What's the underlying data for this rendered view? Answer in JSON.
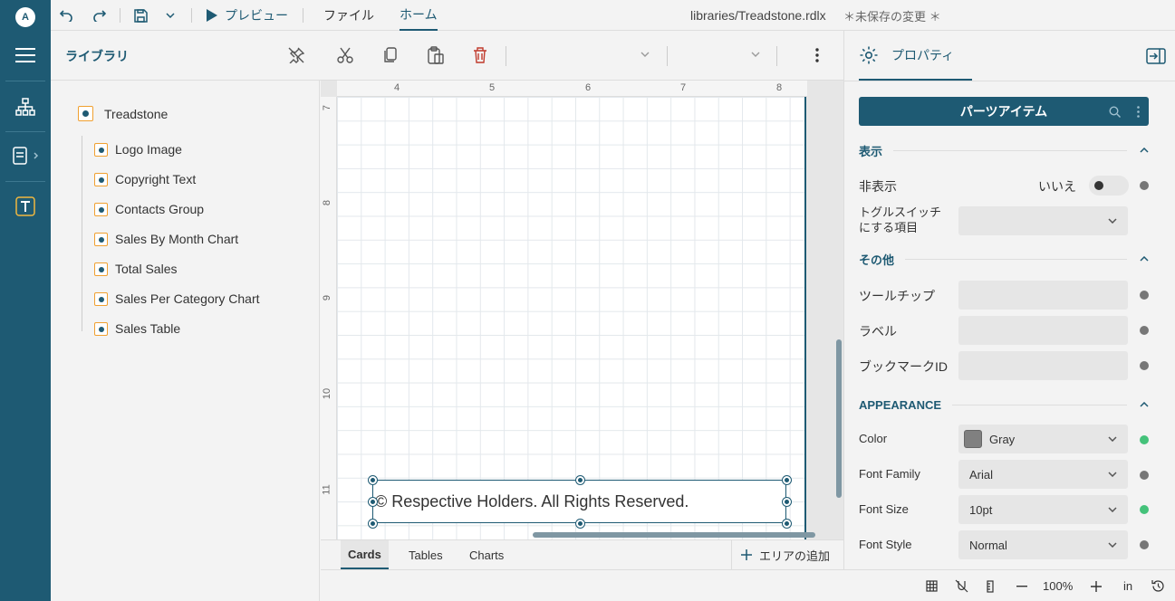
{
  "rail": {
    "logo": "A"
  },
  "topbar": {
    "preview_label": "プレビュー",
    "tabs": [
      {
        "label": "ファイル"
      },
      {
        "label": "ホーム"
      }
    ],
    "filename": "libraries/Treadstone.rdlx",
    "unsaved": "＊未保存の変更 ＊"
  },
  "toolbar": {
    "library_title": "ライブラリ"
  },
  "library": {
    "root": "Treadstone",
    "items": [
      {
        "label": "Logo Image"
      },
      {
        "label": "Copyright Text"
      },
      {
        "label": "Contacts Group"
      },
      {
        "label": "Sales By Month Chart"
      },
      {
        "label": "Total Sales"
      },
      {
        "label": "Sales Per Category Chart"
      },
      {
        "label": "Sales Table"
      }
    ]
  },
  "canvas": {
    "ruler_top": [
      "4",
      "5",
      "6",
      "7",
      "8"
    ],
    "ruler_left": [
      "7",
      "8",
      "9",
      "10",
      "11"
    ],
    "selected_text": "© Respective Holders. All Rights Reserved."
  },
  "bottom_tabs": {
    "tabs": [
      {
        "label": "Cards"
      },
      {
        "label": "Tables"
      },
      {
        "label": "Charts"
      }
    ],
    "add_area": "エリアの追加"
  },
  "statusbar": {
    "zoom": "100%",
    "unit": "in"
  },
  "properties": {
    "tab_label": "プロパティ",
    "parts_button": "パーツアイテム",
    "sections": {
      "display": "表示",
      "other": "その他",
      "appearance": "APPEARANCE"
    },
    "hidden_label": "非表示",
    "hidden_value": "いいえ",
    "toggle_item_label": "トグルスイッチ\nにする項目",
    "tooltip_label": "ツールチップ",
    "label_label": "ラベル",
    "bookmark_label": "ブックマークID",
    "color_label": "Color",
    "color_value": "Gray",
    "font_family_label": "Font Family",
    "font_family_value": "Arial",
    "font_size_label": "Font Size",
    "font_size_value": "10pt",
    "font_style_label": "Font Style",
    "font_style_value": "Normal"
  },
  "colors": {
    "accent": "#1e5a73",
    "modified_indicator": "#44c27a",
    "swatch": "#808080"
  }
}
